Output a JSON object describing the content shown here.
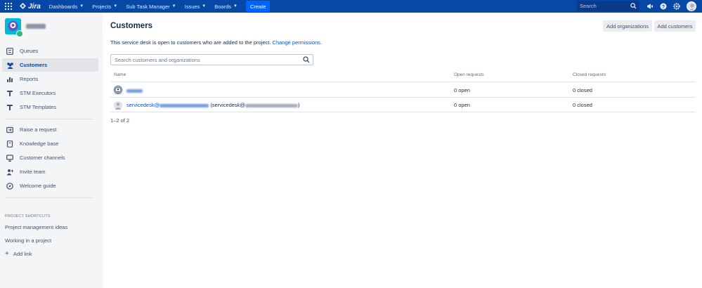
{
  "topnav": {
    "logo_text": "Jira",
    "menus": [
      {
        "label": "Dashboards"
      },
      {
        "label": "Projects"
      },
      {
        "label": "Sub Task Manager"
      },
      {
        "label": "Issues"
      },
      {
        "label": "Boards"
      }
    ],
    "create_label": "Create",
    "search_placeholder": "Search",
    "icons": [
      "apps-grid-icon",
      "notification-icon",
      "help-icon",
      "settings-icon",
      "user-avatar"
    ]
  },
  "sidebar": {
    "main_items": [
      {
        "label": "Queues",
        "icon": "queues-icon"
      },
      {
        "label": "Customers",
        "icon": "customers-icon",
        "active": true
      },
      {
        "label": "Reports",
        "icon": "reports-icon"
      },
      {
        "label": "STM Executors",
        "icon": "stm-executors-icon"
      },
      {
        "label": "STM Templates",
        "icon": "stm-templates-icon"
      }
    ],
    "secondary_items": [
      {
        "label": "Raise a request",
        "icon": "raise-request-icon"
      },
      {
        "label": "Knowledge base",
        "icon": "knowledge-base-icon"
      },
      {
        "label": "Customer channels",
        "icon": "customer-channels-icon"
      },
      {
        "label": "Invite team",
        "icon": "invite-team-icon"
      },
      {
        "label": "Welcome guide",
        "icon": "welcome-guide-icon"
      }
    ],
    "shortcuts_heading": "PROJECT SHORTCUTS",
    "shortcuts": [
      {
        "label": "Project management ideas"
      },
      {
        "label": "Working in a project"
      }
    ],
    "add_link_label": "Add link"
  },
  "main": {
    "title": "Customers",
    "add_organizations_label": "Add organizations",
    "add_customers_label": "Add customers",
    "description": "This service desk is open to customers who are added to the project.",
    "change_permissions_label": "Change permissions.",
    "search_placeholder": "Search customers and organizations",
    "table": {
      "columns": [
        "Name",
        "Open requests",
        "Closed requests"
      ],
      "rows": [
        {
          "name": "",
          "email_suffix": "",
          "open": "0 open",
          "closed": "0 closed"
        },
        {
          "name": "servicedesk@",
          "email_suffix": "(servicedesk@",
          "email_end": ")",
          "open": "0 open",
          "closed": "0 closed"
        }
      ]
    },
    "pager": "1–2 of 2"
  },
  "colors": {
    "topnav_bg": "#0747a6",
    "create_bg": "#0065ff",
    "link": "#0052cc",
    "sidebar_bg": "#f4f5f7"
  }
}
